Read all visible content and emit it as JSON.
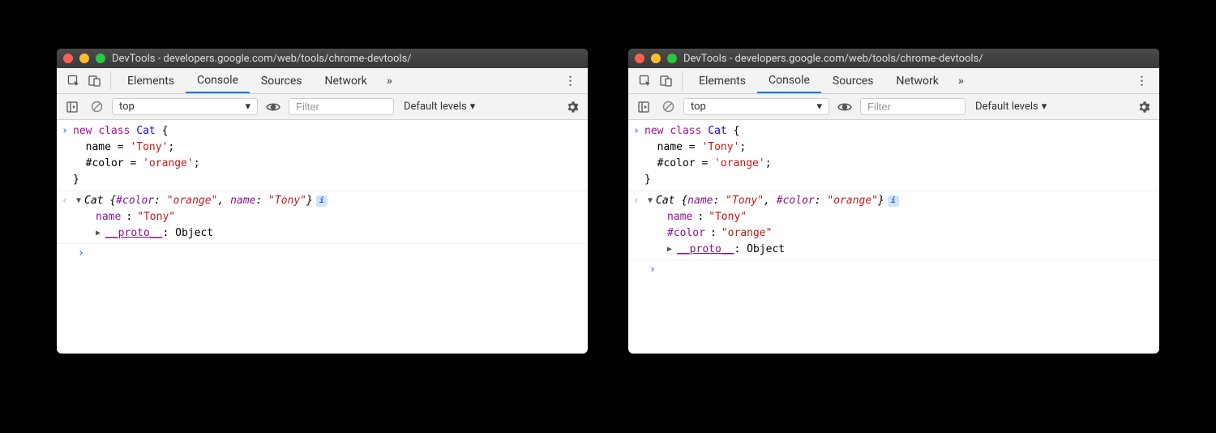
{
  "window_title": "DevTools - developers.google.com/web/tools/chrome-devtools/",
  "tabs": [
    "Elements",
    "Console",
    "Sources",
    "Network"
  ],
  "active_tab": "Console",
  "overflow": "»",
  "toolbar": {
    "context": "top",
    "filter_placeholder": "Filter",
    "levels": "Default levels"
  },
  "code_lines": {
    "l1_kw_new": "new",
    "l1_kw_class": "class",
    "l1_cls": "Cat",
    "l1_brace": " {",
    "l2_indent": "  name = ",
    "l2_str": "'Tony'",
    "l2_semi": ";",
    "l3_indent": "  #color = ",
    "l3_str": "'orange'",
    "l3_semi": ";",
    "l4": "}"
  },
  "left_output": {
    "header_cls": "Cat",
    "header_open": " {",
    "header_k1": "#color",
    "header_v1": "\"orange\"",
    "header_sep": ", ",
    "header_k2": "name",
    "header_v2": "\"Tony\"",
    "header_close": "}",
    "line1_key": "name",
    "line1_val": "\"Tony\"",
    "proto_key": "__proto__",
    "proto_val": "Object"
  },
  "right_output": {
    "header_cls": "Cat",
    "header_open": " {",
    "header_k1": "name",
    "header_v1": "\"Tony\"",
    "header_sep": ", ",
    "header_k2": "#color",
    "header_v2": "\"orange\"",
    "header_close": "}",
    "line1_key": "name",
    "line1_val": "\"Tony\"",
    "line2_key": "#color",
    "line2_val": "\"orange\"",
    "proto_key": "__proto__",
    "proto_val": "Object"
  },
  "info_glyph": "i",
  "colon": ": "
}
